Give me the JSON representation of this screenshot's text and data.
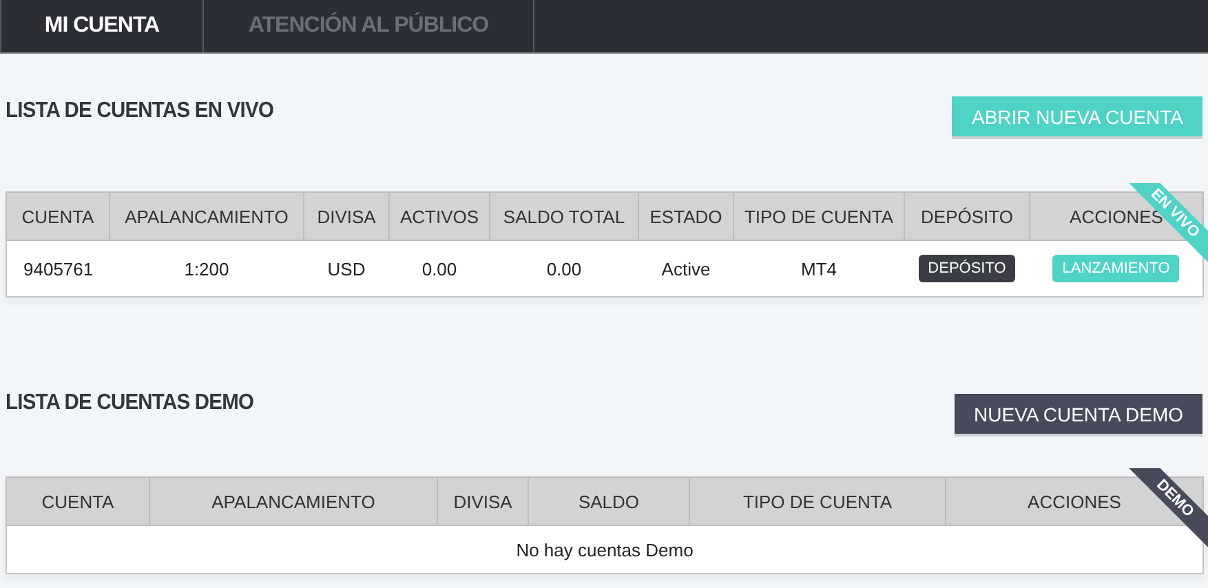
{
  "tabs": [
    {
      "label": "MI CUENTA",
      "selected": true
    },
    {
      "label": "ATENCIÓN AL PÚBLICO",
      "selected": false
    }
  ],
  "sections": [
    {
      "kind": "live",
      "title": "LISTA DE CUENTAS EN VIVO",
      "button": "ABRIR NUEVA CUENTA",
      "ribbon": "EN VIVO",
      "columns": [
        "CUENTA",
        "APALANCAMIENTO",
        "DIVISA",
        "ACTIVOS",
        "SALDO TOTAL",
        "ESTADO",
        "TIPO DE CUENTA",
        "DEPÓSITO",
        "ACCIONES"
      ],
      "rows": [
        [
          {
            "kind": "text",
            "text": "9405761"
          },
          {
            "kind": "text",
            "text": "1:200"
          },
          {
            "kind": "text",
            "text": "USD"
          },
          {
            "kind": "text",
            "text": "0.00"
          },
          {
            "kind": "text",
            "text": "0.00"
          },
          {
            "kind": "text",
            "text": "Active"
          },
          {
            "kind": "text",
            "text": "MT4"
          },
          {
            "kind": "button",
            "text": "DEPÓSITO",
            "color": "#3a3d44"
          },
          {
            "kind": "button",
            "text": "LANZAMIENTO",
            "color": "#4fd3c4"
          }
        ]
      ]
    },
    {
      "kind": "demo",
      "title": "LISTA DE CUENTAS DEMO",
      "button": "NUEVA CUENTA DEMO",
      "ribbon": "DEMO",
      "columns": [
        "CUENTA",
        "APALANCAMIENTO",
        "DIVISA",
        "SALDO",
        "TIPO DE CUENTA",
        "ACCIONES"
      ],
      "empty_message": "No hay cuentas Demo"
    }
  ]
}
